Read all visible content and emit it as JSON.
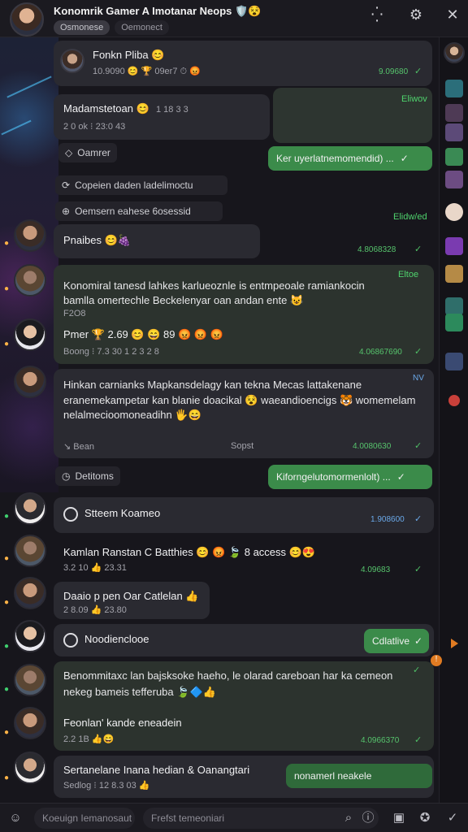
{
  "header": {
    "title": "Konomrik Gamer A Imotanar Neops",
    "title_emojis": "🛡️😵",
    "chips": [
      "Osmonese",
      "Oemonect"
    ],
    "icons": [
      "dots-icon",
      "gear-icon",
      "close-icon"
    ]
  },
  "messages": [
    {
      "name": "Fonkn Pliba",
      "emoji": "😊",
      "meta": "10.9090 😊 🏆 09er7 ⏱ 😡",
      "time": "9.09680",
      "ack": "✓"
    },
    {
      "tag": "Eliwov"
    },
    {
      "name": "Madamstetoan",
      "emoji": "😊",
      "meta_top": "1 18 3 3",
      "meta": "2 0 ok ⁝  23:0 43",
      "sub": "Oamrer"
    },
    {
      "pill": "Ker uyerlatnemomendid) ...",
      "ack": "✓"
    },
    {
      "sys1": "Copeien daden ladelimoctu"
    },
    {
      "sys2": "Oemsern eahese 6osessid"
    },
    {
      "tag": "Elidw/ed"
    },
    {
      "name": "Pnaibes",
      "emoji": "😊🍇",
      "time": "4.8068328"
    },
    {
      "tag": "Eltoe"
    },
    {
      "line1": "Konomiral tanesd lahkes karlueoznle is entmpeoale ramiankocin",
      "line2": "bamlla omertechle Beckelenyar oan andan ente",
      "line2_emoji": "😺",
      "meta": "F2O8",
      "name2": "Pmer",
      "row2": "🏆 2.69 😊 😄 89 😡 😡 😡",
      "meta2": "Boong ⁝ 7.3 30 1 2 3 2 8",
      "time": "4.06867690"
    },
    {
      "line1": "Hinkan carnianks Mapkansdelagy kan tekna Mecas lattakenane",
      "line2": "eranemekampetar kan blanie doacikal 😵 waeandioencigs 🐯 womemelam",
      "line3": "nelalmecioomoneadihn 🖐️😄",
      "foot_left": "Bean",
      "foot_mid": "Sopst",
      "time": "4.0080630",
      "tag": "NV"
    },
    {
      "sys": "Detitoms"
    },
    {
      "pill": "Kiforngelutomormenlolt) ...",
      "ack": "✓"
    },
    {
      "name": "Stteem Koameo",
      "time": "1.908600"
    },
    {
      "name": "Kamlan Ranstan C Batthies",
      "emoji": "😊 😡 🍃 8 access 😊😍",
      "meta": "3.2 10 👍 23.31",
      "time": "4.09683"
    },
    {
      "name": "Daaio p pen  Oar Catlelan",
      "emoji": "👍",
      "meta": "2 8.09 👍 23.80"
    },
    {
      "name": "Noodienclooe",
      "pill": "Cdlatlive",
      "ack": "✓"
    },
    {
      "line1": "Benommitaxc lan bajsksoke haeho, le olarad careboan har ka cemeon",
      "line2": "nekeg bameis tefferuba",
      "line2_emoji": "🍃🔷👍",
      "name2": "Feonlan' kande eneadein",
      "meta2": "2.2 1B 👍😄",
      "time": "4.0966370"
    },
    {
      "name": "Sertanelane Inana hedian & Oanangtari",
      "meta": "Sedlog ⁝ 12 8.3 03 👍",
      "pill": "nonamerl neakele"
    }
  ],
  "composer": {
    "left_placeholder": "Koeuign Iemanosaut",
    "main_placeholder": "Frefst temeoniari"
  },
  "colors": {
    "accent_green": "#3b8b4a",
    "time_green": "#56c36c",
    "badge_orange": "#e07b22"
  }
}
